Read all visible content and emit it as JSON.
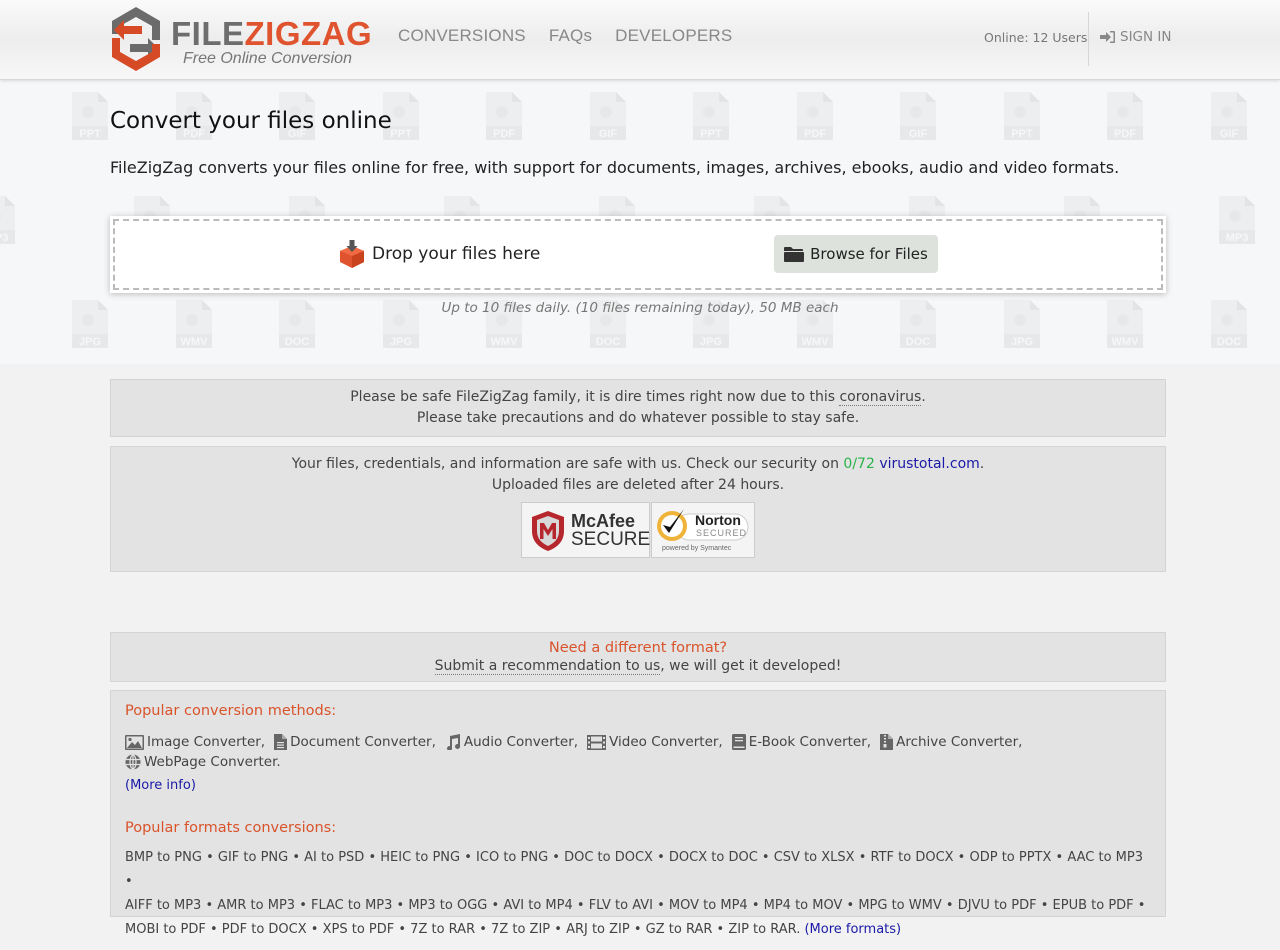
{
  "header": {
    "logo": {
      "title_part1": "FILE",
      "title_part2": "ZIGZAG",
      "subtitle": "Free Online Conversion"
    },
    "nav": [
      {
        "label": "CONVERSIONS"
      },
      {
        "label": "FAQs"
      },
      {
        "label": "DEVELOPERS"
      }
    ],
    "online_status": "Online: 12 Users",
    "sign_in": {
      "label": "SIGN IN",
      "icon": "sign-in-icon"
    }
  },
  "hero": {
    "title": "Convert your files online",
    "description": "FileZigZag converts your files online for free, with support for documents, images, archives, ebooks, audio and video formats.",
    "drop_label": "Drop your files here",
    "drop_icon": "download-box-icon",
    "browse_label": "Browse for Files",
    "browse_icon": "folder-icon",
    "limit_note": "Up to 10 files daily. (10 files remaining today), 50 MB each",
    "background_file_types": [
      "PPT",
      "PDF",
      "GIF",
      "MP3",
      "JPG",
      "WMV",
      "DOC"
    ]
  },
  "covid_notice": {
    "line1_prefix": "Please be safe FileZigZag family, it is dire times right now due to this ",
    "line1_link": "coronavirus",
    "line1_suffix": ".",
    "line2": "Please take precautions and do whatever possible to stay safe."
  },
  "security": {
    "line1_prefix": "Your files, credentials, and information are safe with us. Check our security on ",
    "score": "0/72",
    "link": "virustotal.com",
    "line1_suffix": ".",
    "line2": "Uploaded files are deleted after 24 hours.",
    "badges": [
      {
        "name": "McAfee",
        "line1": "McAfee",
        "line2": "SECURE"
      },
      {
        "name": "Norton",
        "line1": "Norton",
        "line2": "SECURED",
        "line3": "powered by Symantec"
      }
    ]
  },
  "need_format": {
    "title": "Need a different format?",
    "link": "Submit a recommendation to us",
    "suffix": ", we will get it developed!"
  },
  "popular": {
    "methods_heading": "Popular conversion methods:",
    "methods": [
      {
        "label": "Image Converter,",
        "icon": "image-icon"
      },
      {
        "label": "Document Converter,",
        "icon": "document-icon"
      },
      {
        "label": "Audio Converter,",
        "icon": "music-icon"
      },
      {
        "label": "Video Converter,",
        "icon": "film-icon"
      },
      {
        "label": "E-Book Converter,",
        "icon": "book-icon"
      },
      {
        "label": "Archive Converter,",
        "icon": "archive-icon"
      },
      {
        "label": "WebPage Converter.",
        "icon": "globe-icon"
      }
    ],
    "more_info": "(More info)",
    "formats_heading": "Popular formats conversions:",
    "formats": [
      "BMP to PNG",
      "GIF to PNG",
      "AI to PSD",
      "HEIC to PNG",
      "ICO to PNG",
      "DOC to DOCX",
      "DOCX to DOC",
      "CSV to XLSX",
      "RTF to DOCX",
      "ODP to PPTX",
      "AAC to MP3",
      "AIFF to MP3",
      "AMR to MP3",
      "FLAC to MP3",
      "MP3 to OGG",
      "AVI to MP4",
      "FLV to AVI",
      "MOV to MP4",
      "MP4 to MOV",
      "MPG to WMV",
      "DJVU to PDF",
      "EPUB to PDF",
      "MOBI to PDF",
      "PDF to DOCX",
      "XPS to PDF",
      "7Z to RAR",
      "7Z to ZIP",
      "ARJ to ZIP",
      "GZ to RAR",
      "ZIP to RAR"
    ],
    "more_formats": "(More formats)"
  },
  "colors": {
    "accent": "#e0532f",
    "heading_orange": "#d9532b",
    "link_blue": "#1a1aa6",
    "score_green": "#2bb34a"
  }
}
